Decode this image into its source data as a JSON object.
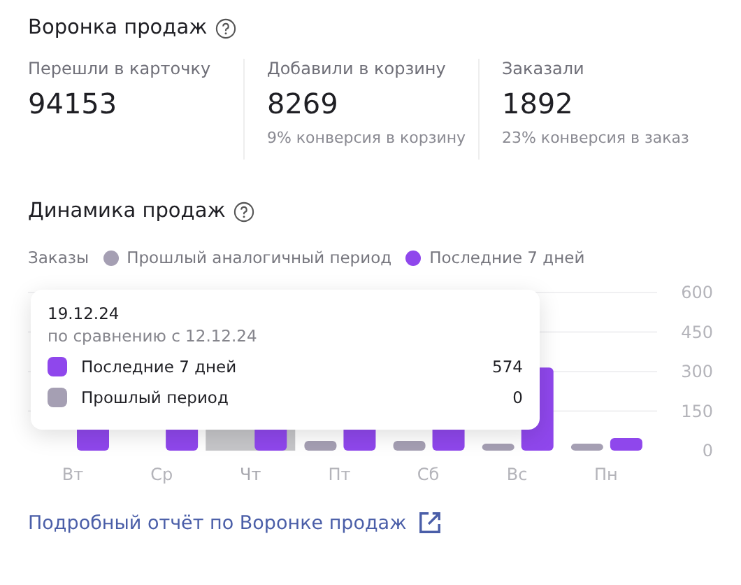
{
  "funnel": {
    "title": "Воронка продаж",
    "metrics": [
      {
        "label": "Перешли в карточку",
        "value": "94153"
      },
      {
        "label": "Добавили в корзину",
        "value": "8269",
        "note": "9% конверсия в корзину"
      },
      {
        "label": "Заказали",
        "value": "1892",
        "note": "23% конверсия в заказ"
      }
    ]
  },
  "dynamics": {
    "title": "Динамика продаж",
    "legend_label": "Заказы",
    "chart_data": {
      "type": "bar",
      "grid": true,
      "categories": [
        "Вт",
        "Ср",
        "Чт",
        "Пт",
        "Сб",
        "Вс",
        "Пн"
      ],
      "ylim": [
        0,
        600
      ],
      "yticks": [
        0,
        150,
        300,
        450,
        600
      ],
      "series": [
        {
          "name": "Прошлый аналогичный период",
          "color": "#a59fb3",
          "values": [
            0,
            0,
            0,
            37,
            37,
            25,
            20
          ]
        },
        {
          "name": "Последние 7 дней",
          "color": "#8f47ec",
          "values": [
            null,
            null,
            null,
            null,
            null,
            315,
            48
          ]
        }
      ]
    },
    "day_states": [
      {
        "hovered": false
      },
      {
        "hovered": false
      },
      {
        "hovered": true
      },
      {
        "hovered": false
      },
      {
        "hovered": false
      },
      {
        "hovered": false
      },
      {
        "hovered": false
      }
    ],
    "tooltip": {
      "date": "19.12.24",
      "compare": "по сравнению с 12.12.24",
      "rows": [
        {
          "label": "Последние 7 дней",
          "value": "574",
          "color": "#8f47ec"
        },
        {
          "label": "Прошлый период",
          "value": "0",
          "color": "#a59fb3"
        }
      ]
    }
  },
  "report_link": "Подробный отчёт по Воронке продаж"
}
